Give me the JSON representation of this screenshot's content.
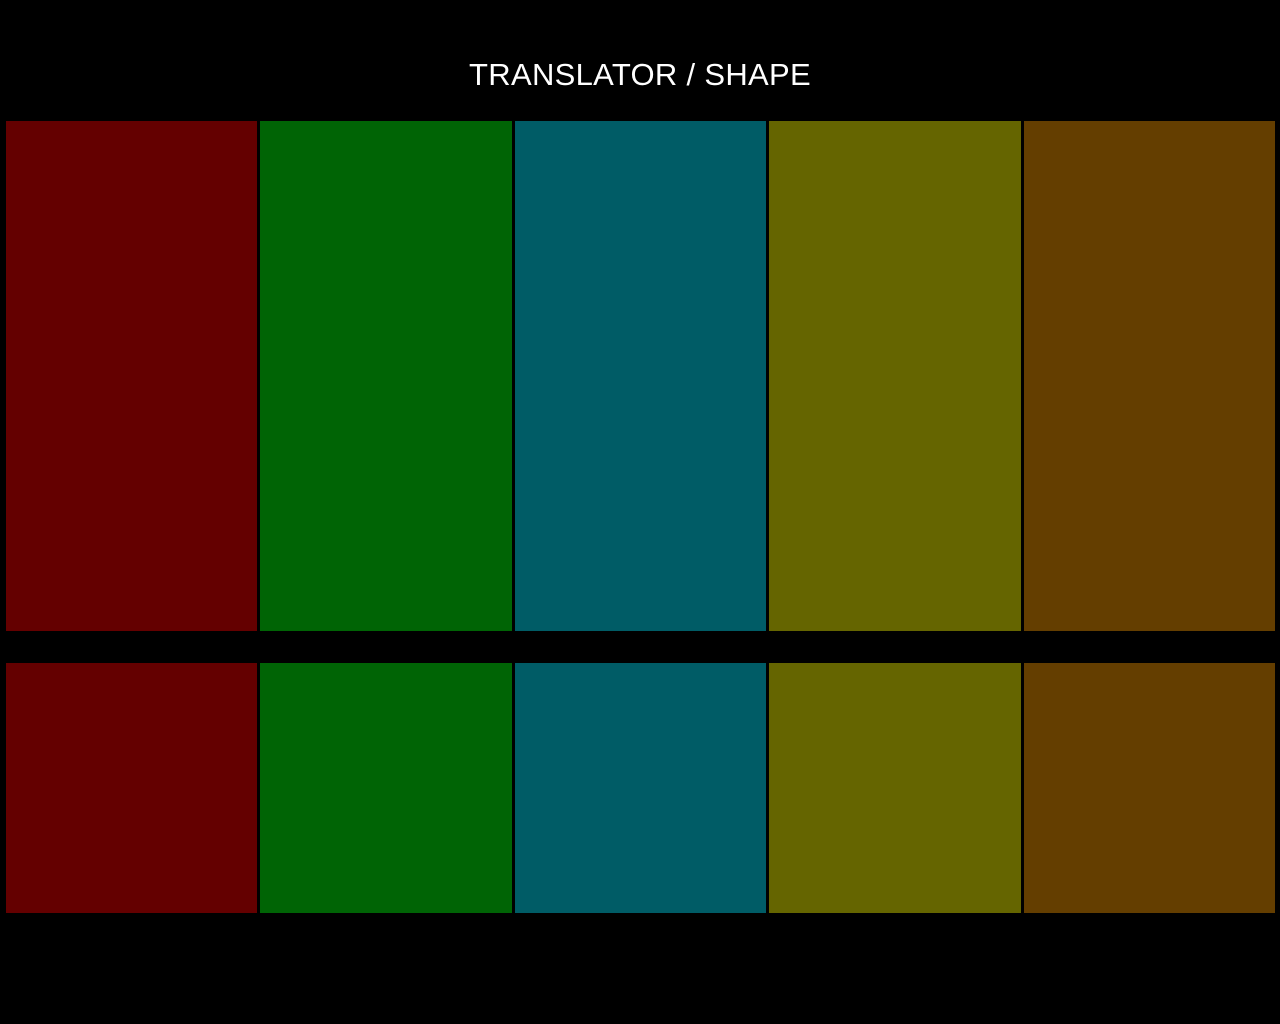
{
  "title": "TRANSLATOR / SHAPE",
  "tiles": [
    {
      "color": "#640000",
      "icon": "red-tile"
    },
    {
      "color": "#006405",
      "icon": "green-tile"
    },
    {
      "color": "#005c66",
      "icon": "teal-tile"
    },
    {
      "color": "#656500",
      "icon": "olive-tile"
    },
    {
      "color": "#643e00",
      "icon": "brown-tile"
    }
  ]
}
